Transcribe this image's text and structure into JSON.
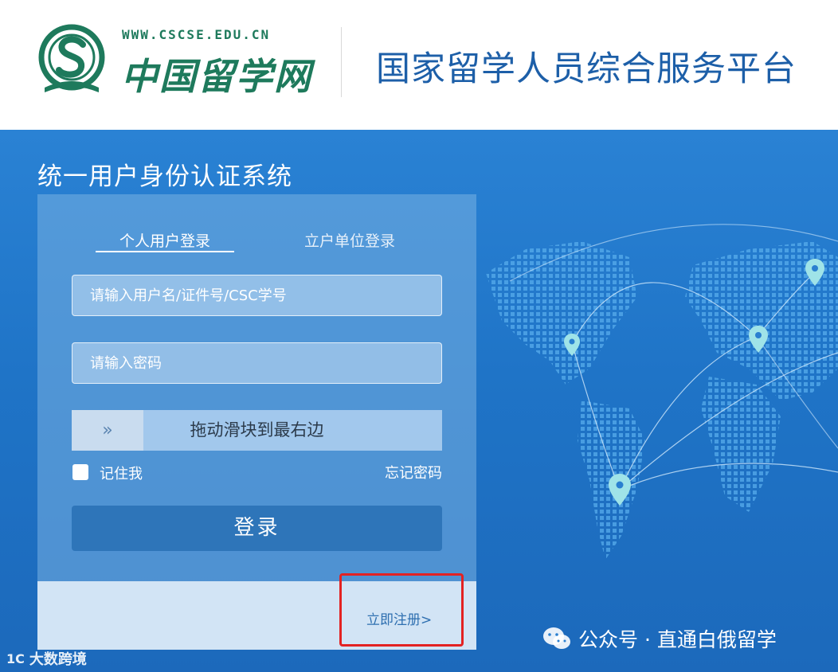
{
  "header": {
    "site_url": "WWW.CSCSE.EDU.CN",
    "site_name": "中国留学网",
    "platform_title": "国家留学人员综合服务平台",
    "colors": {
      "logo_green": "#1e7a5c",
      "title_blue": "#1d5fa8"
    }
  },
  "auth": {
    "system_title": "统一用户身份认证系统",
    "tabs": [
      {
        "label": "个人用户登录",
        "active": true
      },
      {
        "label": "立户单位登录",
        "active": false
      }
    ],
    "username_placeholder": "请输入用户名/证件号/CSC学号",
    "password_placeholder": "请输入密码",
    "slider_handle_glyph": "»",
    "slider_text": "拖动滑块到最右边",
    "remember_label": "记住我",
    "remember_checked": false,
    "forgot_label": "忘记密码",
    "login_label": "登录",
    "register_label": "立即注册>",
    "colors": {
      "banner": "#2a82d4",
      "button": "#2e75b9",
      "highlight": "#e32222"
    }
  },
  "watermarks": {
    "wechat": "公众号 · 直通白俄留学",
    "wechat_icon": "wechat-icon",
    "corner_logo": "1C",
    "corner_text": "大数跨境"
  }
}
